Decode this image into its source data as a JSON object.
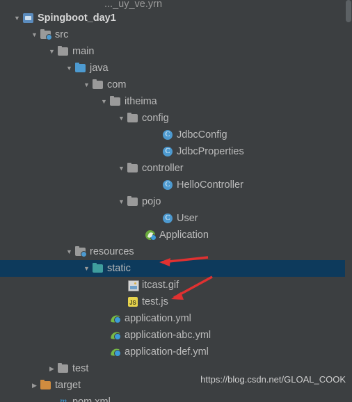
{
  "window": {
    "background": "#3c3f41",
    "selection_color": "#0d3a5c",
    "text_color": "#bbbbbb"
  },
  "watermark": "https://blog.csdn.net/GLOAL_COOK",
  "partial_top_row": {
    "label": "..._uy_ve.yrn"
  },
  "tree": [
    {
      "depth": 0,
      "arrow": "▼",
      "icon": "module-icon",
      "label": "Spingboot_day1",
      "bold": true,
      "selected": false
    },
    {
      "depth": 1,
      "arrow": "▼",
      "icon": "folder-source-root-icon",
      "label": "src",
      "bold": false,
      "selected": false
    },
    {
      "depth": 2,
      "arrow": "▼",
      "icon": "folder-icon",
      "label": "main",
      "bold": false,
      "selected": false
    },
    {
      "depth": 3,
      "arrow": "▼",
      "icon": "folder-java-icon",
      "label": "java",
      "bold": false,
      "selected": false
    },
    {
      "depth": 4,
      "arrow": "▼",
      "icon": "folder-icon",
      "label": "com",
      "bold": false,
      "selected": false
    },
    {
      "depth": 5,
      "arrow": "▼",
      "icon": "folder-icon",
      "label": "itheima",
      "bold": false,
      "selected": false
    },
    {
      "depth": 6,
      "arrow": "▼",
      "icon": "folder-icon",
      "label": "config",
      "bold": false,
      "selected": false
    },
    {
      "depth": 8,
      "arrow": "",
      "icon": "java-class-icon",
      "label": "JdbcConfig",
      "bold": false,
      "selected": false
    },
    {
      "depth": 8,
      "arrow": "",
      "icon": "java-class-icon",
      "label": "JdbcProperties",
      "bold": false,
      "selected": false
    },
    {
      "depth": 6,
      "arrow": "▼",
      "icon": "folder-icon",
      "label": "controller",
      "bold": false,
      "selected": false
    },
    {
      "depth": 8,
      "arrow": "",
      "icon": "java-class-icon",
      "label": "HelloController",
      "bold": false,
      "selected": false
    },
    {
      "depth": 6,
      "arrow": "▼",
      "icon": "folder-icon",
      "label": "pojo",
      "bold": false,
      "selected": false
    },
    {
      "depth": 8,
      "arrow": "",
      "icon": "java-class-icon",
      "label": "User",
      "bold": false,
      "selected": false
    },
    {
      "depth": 7,
      "arrow": "",
      "icon": "spring-boot-application-icon",
      "label": "Application",
      "bold": false,
      "selected": false
    },
    {
      "depth": 3,
      "arrow": "▼",
      "icon": "folder-resources-icon",
      "label": "resources",
      "bold": false,
      "selected": false
    },
    {
      "depth": 4,
      "arrow": "▼",
      "icon": "folder-static-icon",
      "label": "static",
      "bold": false,
      "selected": true
    },
    {
      "depth": 6,
      "arrow": "",
      "icon": "gif-file-icon",
      "label": "itcast.gif",
      "bold": false,
      "selected": false
    },
    {
      "depth": 6,
      "arrow": "",
      "icon": "js-file-icon",
      "label": "test.js",
      "bold": false,
      "selected": false
    },
    {
      "depth": 5,
      "arrow": "",
      "icon": "yml-file-icon",
      "label": "application.yml",
      "bold": false,
      "selected": false
    },
    {
      "depth": 5,
      "arrow": "",
      "icon": "yml-file-icon",
      "label": "application-abc.yml",
      "bold": false,
      "selected": false
    },
    {
      "depth": 5,
      "arrow": "",
      "icon": "yml-file-icon",
      "label": "application-def.yml",
      "bold": false,
      "selected": false
    },
    {
      "depth": 2,
      "arrow": "▶",
      "icon": "folder-icon",
      "label": "test",
      "bold": false,
      "selected": false
    },
    {
      "depth": 1,
      "arrow": "▶",
      "icon": "folder-target-icon",
      "label": "target",
      "bold": false,
      "selected": false
    },
    {
      "depth": 2,
      "arrow": "",
      "icon": "maven-pom-icon",
      "label": "pom.xml",
      "bold": false,
      "selected": false
    }
  ],
  "annotations": [
    {
      "name": "red-arrow-static",
      "color": "#e03131"
    },
    {
      "name": "red-arrow-testjs",
      "color": "#e03131"
    }
  ]
}
